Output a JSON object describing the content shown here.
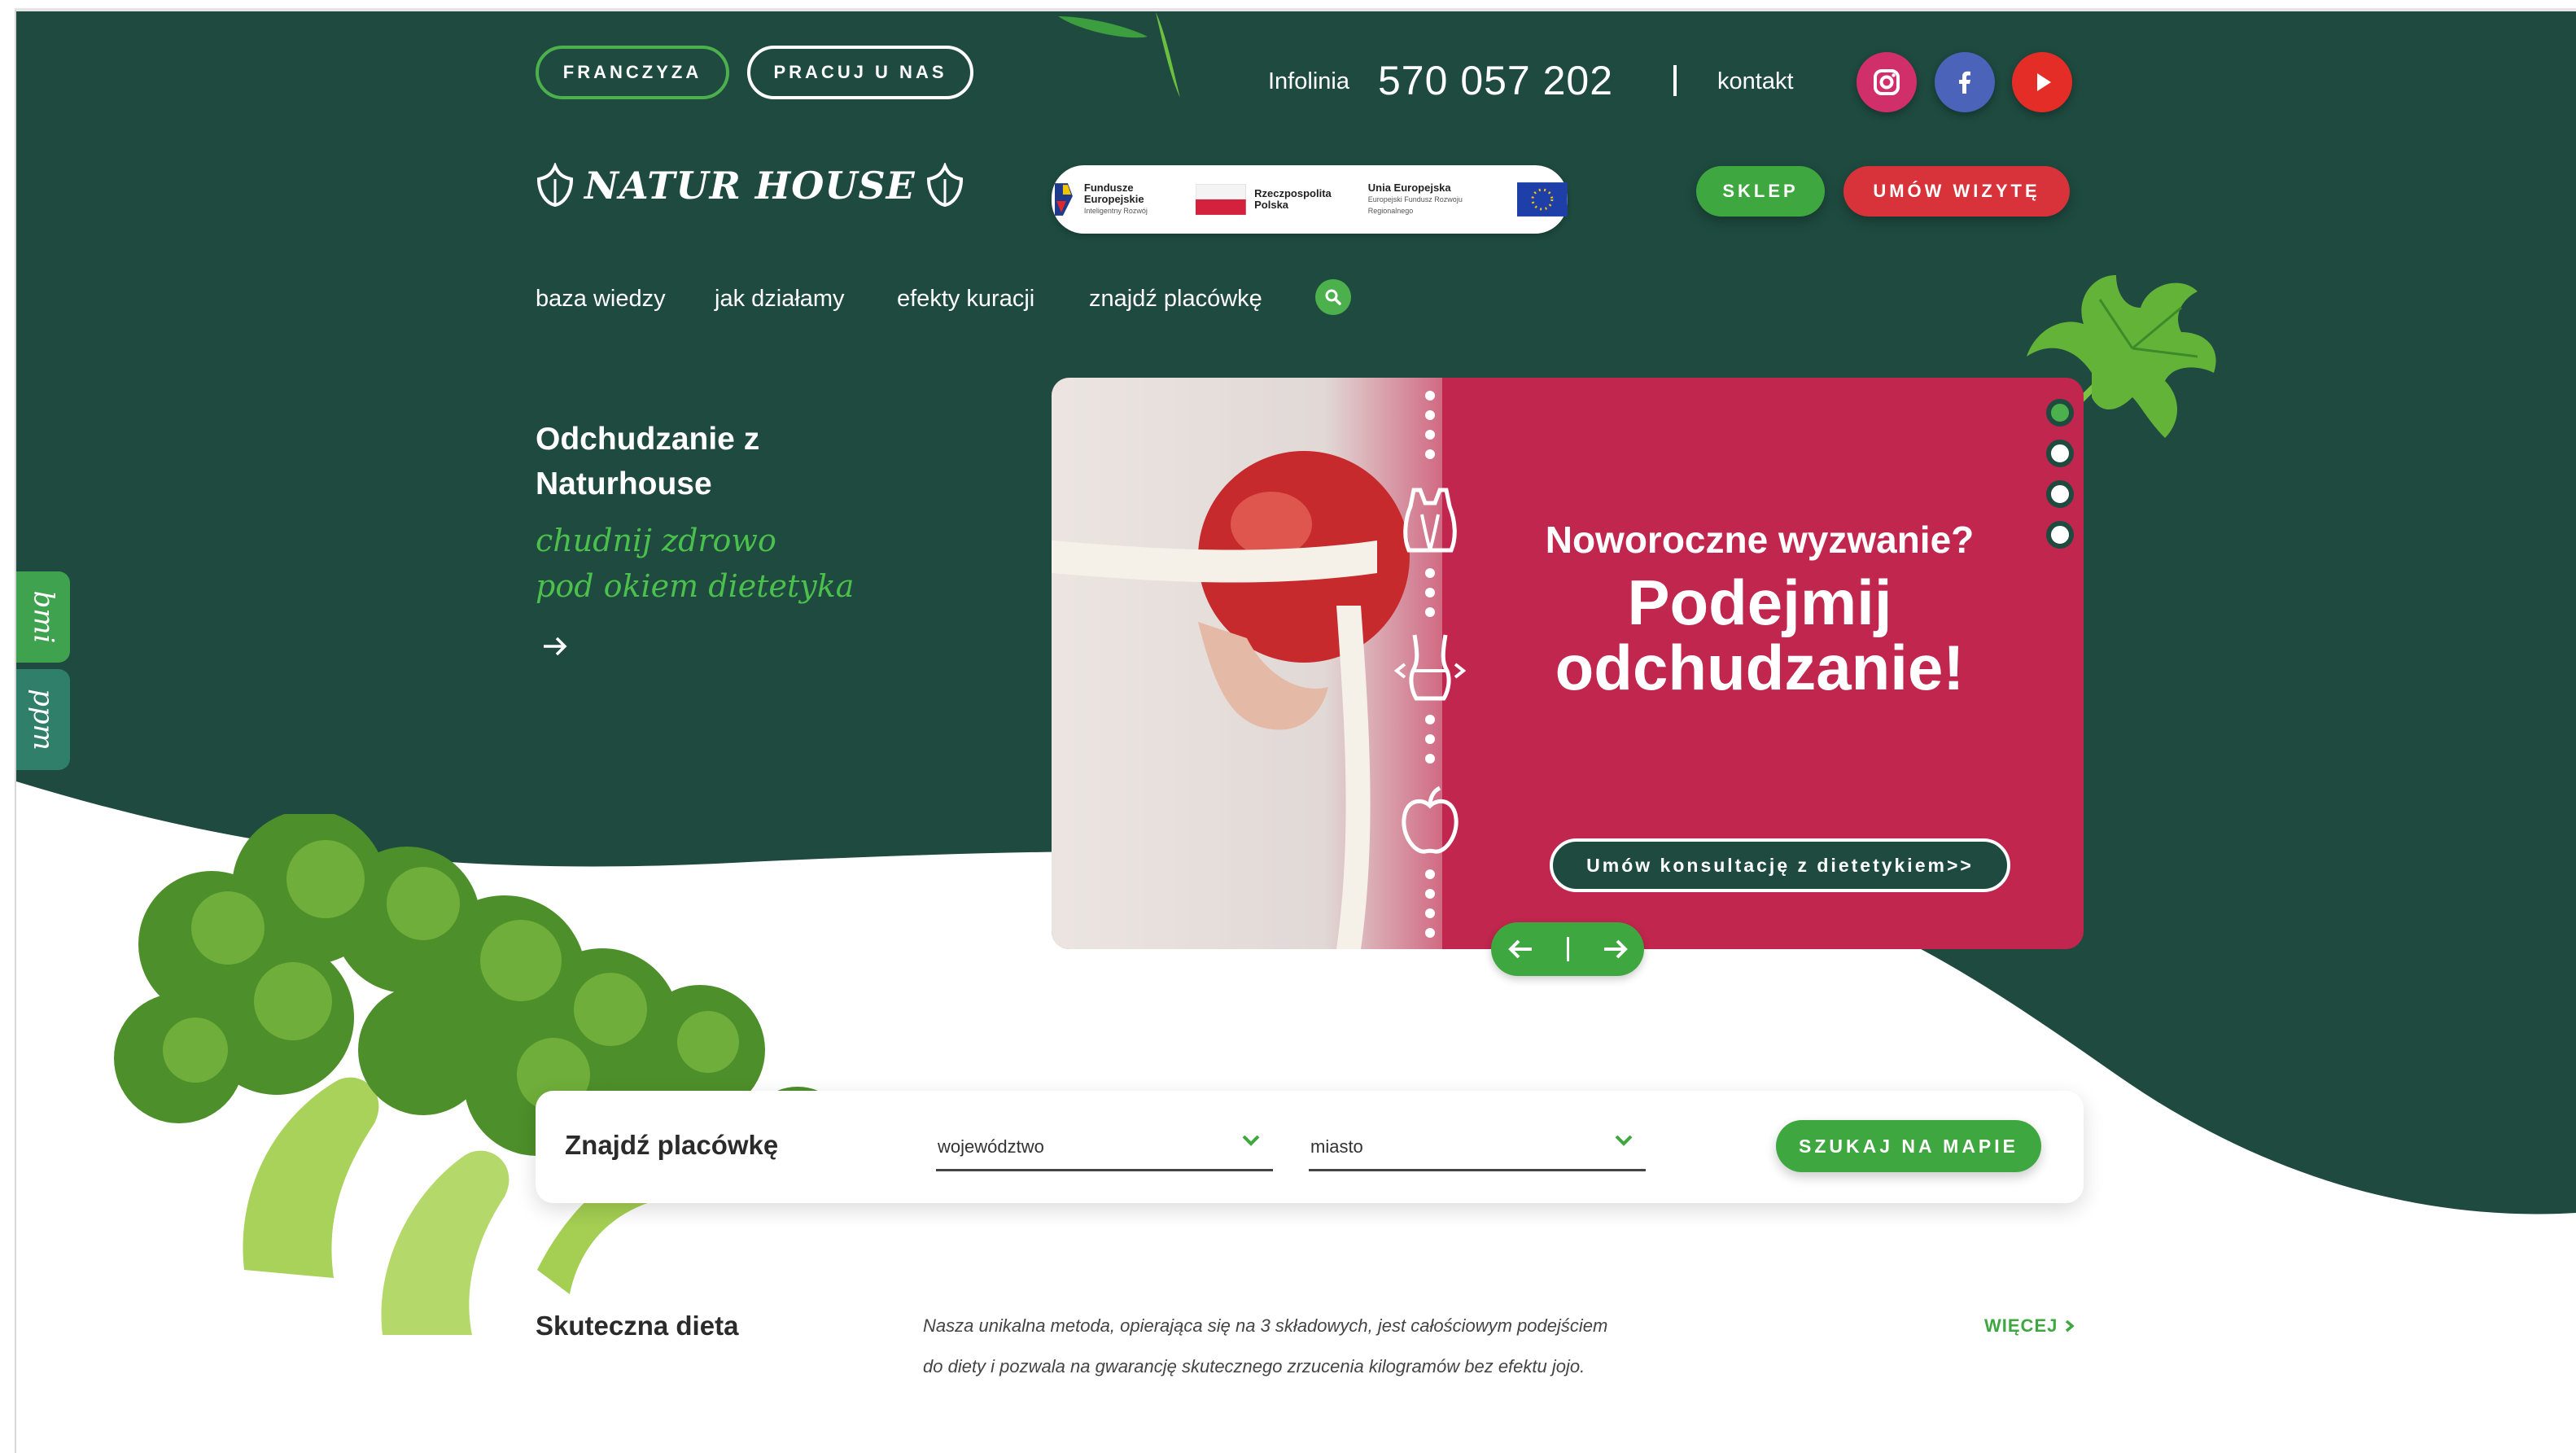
{
  "header": {
    "franchise_label": "FRANCZYZA",
    "jobs_label": "PRACUJ U NAS",
    "hotline_label": "Infolinia",
    "hotline_number": "570 057 202",
    "contact_label": "kontakt",
    "social": [
      {
        "name": "instagram-icon",
        "color": "#d12f6a"
      },
      {
        "name": "facebook-icon",
        "color": "#4b63b8"
      },
      {
        "name": "youtube-icon",
        "color": "#e52d27"
      }
    ],
    "logo_text": "NATUR HOUSE",
    "shop_label": "SKLEP",
    "appointment_label": "UMÓW WIZYTĘ"
  },
  "eu_logos": [
    {
      "title": "Fundusze Europejskie",
      "subtitle": "Inteligentny Rozwój"
    },
    {
      "title": "Rzeczpospolita Polska",
      "subtitle": ""
    },
    {
      "title": "Unia Europejska",
      "subtitle": "Europejski Fundusz Rozwoju Regionalnego"
    }
  ],
  "nav": {
    "items": [
      "baza wiedzy",
      "jak działamy",
      "efekty kuracji",
      "znajdź placówkę"
    ]
  },
  "hero": {
    "title_line1": "Odchudzanie z",
    "title_line2": "Naturhouse",
    "script_line1": "chudnij zdrowo",
    "script_line2": "pod okiem dietetyka"
  },
  "slider": {
    "question": "Noworoczne wyzwanie?",
    "headline_line1": "Podejmij",
    "headline_line2": "odchudzanie!",
    "cta_label": "Umów konsultację z dietetykiem>>",
    "slide_count": 4,
    "active_slide": 1,
    "accent_color": "#c0264e"
  },
  "side_tabs": {
    "bmi": "bmi",
    "ppm": "ppm"
  },
  "finder": {
    "title": "Znajdź placówkę",
    "region_placeholder": "województwo",
    "city_placeholder": "miasto",
    "search_label": "SZUKAJ NA MAPIE"
  },
  "diet": {
    "title": "Skuteczna dieta",
    "description_line1": "Nasza unikalna metoda, opierająca się na 3 składowych, jest całościowym podejściem",
    "description_line2": "do diety i pozwala na gwarancję skutecznego zrzucenia kilogramów bez efektu jojo.",
    "more_label": "WIĘCEJ"
  },
  "colors": {
    "brand_dark_green": "#1e4a3f",
    "brand_green": "#3fa73f",
    "accent_red": "#d8333a"
  }
}
